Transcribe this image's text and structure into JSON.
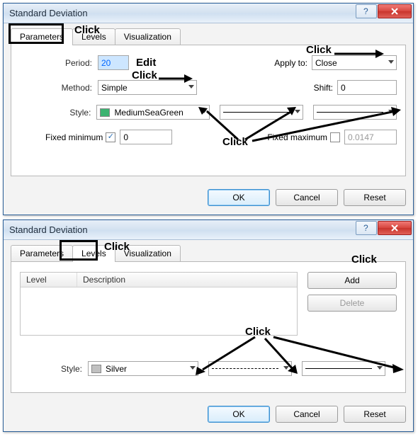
{
  "dialog1": {
    "title": "Standard Deviation",
    "tabs": {
      "parameters": "Parameters",
      "levels": "Levels",
      "visualization": "Visualization"
    },
    "period_label": "Period:",
    "period_value": "20",
    "apply_to_label": "Apply to:",
    "apply_to_value": "Close",
    "method_label": "Method:",
    "method_value": "Simple",
    "shift_label": "Shift:",
    "shift_value": "0",
    "style_label": "Style:",
    "style_color_name": "MediumSeaGreen",
    "style_color_hex": "#3cb371",
    "fixed_min_label": "Fixed minimum",
    "fixed_min_checked": true,
    "fixed_min_value": "0",
    "fixed_max_label": "Fixed maximum",
    "fixed_max_checked": false,
    "fixed_max_value": "0.0147"
  },
  "dialog2": {
    "title": "Standard Deviation",
    "tabs": {
      "parameters": "Parameters",
      "levels": "Levels",
      "visualization": "Visualization"
    },
    "table": {
      "col_level": "Level",
      "col_desc": "Description"
    },
    "add_label": "Add",
    "delete_label": "Delete",
    "style_label": "Style:",
    "style_color_name": "Silver",
    "style_color_hex": "#c0c0c0"
  },
  "buttons": {
    "ok": "OK",
    "cancel": "Cancel",
    "reset": "Reset"
  },
  "annot": {
    "click": "Click",
    "edit": "Edit"
  }
}
